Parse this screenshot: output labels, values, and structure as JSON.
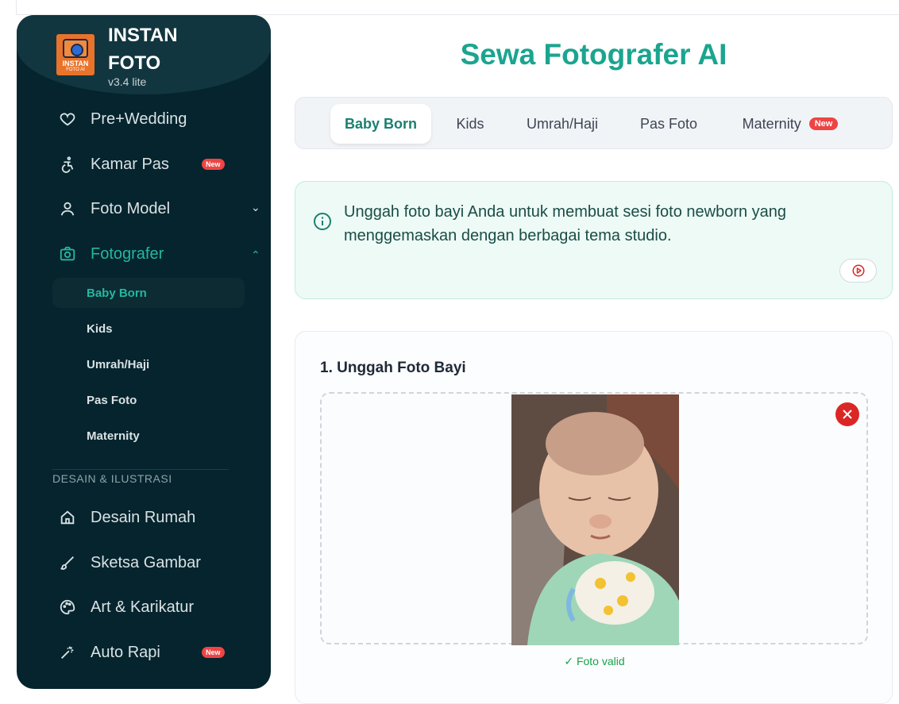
{
  "brand": {
    "line1": "INSTAN",
    "line2": "FOTO",
    "version": "v3.4 lite",
    "logo_text": "INSTAN",
    "logo_sub": "FOTO AI"
  },
  "sidebar": {
    "items": [
      {
        "label": "Pre+Wedding",
        "icon": "heart-icon"
      },
      {
        "label": "Kamar Pas",
        "icon": "accessibility-icon",
        "badge": "New"
      },
      {
        "label": "Foto Model",
        "icon": "user-icon",
        "chevron": "down"
      },
      {
        "label": "Fotografer",
        "icon": "camera-icon",
        "chevron": "up",
        "active": true
      }
    ],
    "subitems": [
      "Baby Born",
      "Kids",
      "Umrah/Haji",
      "Pas Foto",
      "Maternity"
    ],
    "section_label": "DESAIN & ILUSTRASI",
    "section_items": [
      {
        "label": "Desain Rumah",
        "icon": "home-icon"
      },
      {
        "label": "Sketsa Gambar",
        "icon": "brush-icon"
      },
      {
        "label": "Art & Karikatur",
        "icon": "palette-icon"
      },
      {
        "label": "Auto Rapi",
        "icon": "magic-wand-icon",
        "badge": "New"
      }
    ]
  },
  "main": {
    "title": "Sewa Fotografer AI",
    "tabs": [
      {
        "label": "Baby Born",
        "active": true
      },
      {
        "label": "Kids"
      },
      {
        "label": "Umrah/Haji"
      },
      {
        "label": "Pas Foto"
      },
      {
        "label": "Maternity",
        "badge": "New"
      }
    ],
    "info_text": "Unggah foto bayi Anda untuk membuat sesi foto newborn yang menggemaskan dengan berbagai tema studio.",
    "upload_title": "1. Unggah Foto Bayi",
    "valid_text": "✓ Foto valid"
  },
  "colors": {
    "accent": "#1aa58f",
    "sidebar_bg": "#05242e",
    "badge": "#ef4444",
    "danger": "#dc2626",
    "success": "#16a34a"
  }
}
